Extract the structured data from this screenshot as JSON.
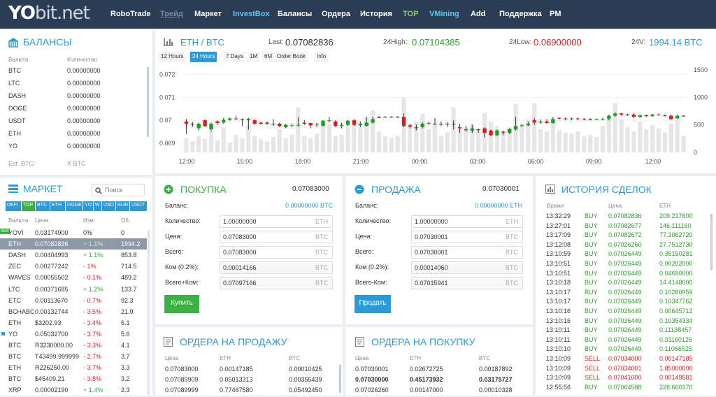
{
  "logo": {
    "yo": "YO",
    "rest": "bit.net"
  },
  "nav": [
    "RoboTrade",
    "Трейд",
    "Маркет",
    "InvestBox",
    "Балансы",
    "Ордера",
    "История",
    "TOP",
    "VMining",
    "Add",
    "Поддержка",
    "PM"
  ],
  "balances": {
    "title": "БАЛАНСЫ",
    "col_currency": "Валюта",
    "col_amount": "Количество",
    "rows": [
      {
        "c": "BTC",
        "v": "0.00000000"
      },
      {
        "c": "LTC",
        "v": "0.00000000"
      },
      {
        "c": "DASH",
        "v": "0.00000000"
      },
      {
        "c": "DOGE",
        "v": "0.00000000"
      },
      {
        "c": "USDT",
        "v": "0.00000000"
      },
      {
        "c": "ETH",
        "v": "0.00000000"
      },
      {
        "c": "YO",
        "v": "0.00000000"
      }
    ],
    "est_label": "Est. BTC:",
    "est_value": "X BTC"
  },
  "market": {
    "title": "МАРКЕТ",
    "search_placeholder": "Поиск",
    "tabs": [
      "DEFI",
      "TOP",
      "BTC",
      "ETH",
      "DOGE",
      "YO",
      "W",
      "USD",
      "RUR",
      "USDT"
    ],
    "col_currency": "Валюта",
    "col_price": "Цена",
    "col_change": "Изм.",
    "col_volume": "Об.",
    "rows": [
      {
        "c": "YOVI",
        "p": "0.03174900",
        "ch": "0%",
        "v": "0",
        "badge": "NEW",
        "tone": "neutral"
      },
      {
        "c": "ETH",
        "p": "0.07082836",
        "ch": "+ 1.1%",
        "v": "1994.2",
        "tone": "up",
        "selected": true
      },
      {
        "c": "DASH",
        "p": "0.00404993",
        "ch": "+ 1.1%",
        "v": "853.8",
        "tone": "up"
      },
      {
        "c": "ZEC",
        "p": "0.00277242",
        "ch": "- 1%",
        "v": "714.5",
        "tone": "down"
      },
      {
        "c": "WAVES",
        "p": "0.00055502",
        "ch": "- 0.1%",
        "v": "489.2",
        "tone": "down"
      },
      {
        "c": "LTC",
        "p": "0.00371685",
        "ch": "+ 1.2%",
        "v": "133.7",
        "tone": "up"
      },
      {
        "c": "ETC",
        "p": "0.00113670",
        "ch": "- 0.7%",
        "v": "92.3",
        "tone": "down"
      },
      {
        "c": "BCHABC",
        "p": "0.00132744",
        "ch": "- 3.5%",
        "v": "21.9",
        "tone": "down"
      },
      {
        "c": "ETH",
        "p": "$3202.93",
        "ch": "- 3.4%",
        "v": "6.1",
        "tone": "down"
      },
      {
        "c": "YO",
        "p": "0.05032700",
        "ch": "- 3.7%",
        "v": "5.6",
        "tone": "down",
        "dot": true
      },
      {
        "c": "BTC",
        "p": "R3230000.00",
        "ch": "- 3.3%",
        "v": "4.1",
        "tone": "down"
      },
      {
        "c": "BTC",
        "p": "T43499.999999",
        "ch": "- 2.7%",
        "v": "3.7",
        "tone": "down"
      },
      {
        "c": "ETH",
        "p": "R226250.00",
        "ch": "- 3.7%",
        "v": "3.3",
        "tone": "down"
      },
      {
        "c": "BTC",
        "p": "$45409.21",
        "ch": "- 3.8%",
        "v": "3.2",
        "tone": "down"
      },
      {
        "c": "XRP",
        "p": "0.00002190",
        "ch": "+ 1.4%",
        "v": "2.3",
        "tone": "up"
      }
    ]
  },
  "ticker": {
    "pair": "ETH / BTC",
    "last_label": "Last:",
    "last_value": "0.07082836",
    "high_label": "24High:",
    "high_value": "0.07104385",
    "low_label": "24Low:",
    "low_value": "0.06900000",
    "vol_label": "24V:",
    "vol_value": "1994.14 BTC"
  },
  "chart_tabs": [
    "12 Hours",
    "24 Hours",
    "7 Days",
    "1M",
    "6M",
    "Order Book",
    "Info"
  ],
  "chart_data": {
    "type": "candlestick",
    "y_left_ticks": [
      "0.072",
      "0.071",
      "0.07",
      "0.069"
    ],
    "y_right_ticks": [
      "1500",
      "1000",
      "500",
      "0"
    ],
    "x_ticks": [
      "12:00",
      "15:00",
      "18:00",
      "21:00",
      "00:00",
      "03:00",
      "06:00",
      "09:00",
      "12:00"
    ],
    "ylim": [
      0.0686,
      0.0722
    ],
    "vol_max": 1500,
    "candles": [
      {
        "o": 0.06995,
        "c": 0.06985,
        "h": 0.07005,
        "l": 0.0694,
        "v": 260
      },
      {
        "o": 0.06985,
        "c": 0.06985,
        "h": 0.06992,
        "l": 0.0697,
        "v": 200
      },
      {
        "o": 0.06965,
        "c": 0.06985,
        "h": 0.0699,
        "l": 0.06955,
        "v": 300
      },
      {
        "o": 0.07,
        "c": 0.06975,
        "h": 0.07005,
        "l": 0.0697,
        "v": 240
      },
      {
        "o": 0.0696,
        "c": 0.06985,
        "h": 0.0699,
        "l": 0.0695,
        "v": 380
      },
      {
        "o": 0.06995,
        "c": 0.06988,
        "h": 0.07,
        "l": 0.0698,
        "v": 220
      },
      {
        "o": 0.0699,
        "c": 0.07002,
        "h": 0.0701,
        "l": 0.06985,
        "v": 460
      },
      {
        "o": 0.07002,
        "c": 0.07008,
        "h": 0.07012,
        "l": 0.06998,
        "v": 180
      },
      {
        "o": 0.07008,
        "c": 0.07005,
        "h": 0.0702,
        "l": 0.07,
        "v": 320
      },
      {
        "o": 0.07005,
        "c": 0.07005,
        "h": 0.07008,
        "l": 0.06975,
        "v": 260
      },
      {
        "o": 0.07005,
        "c": 0.07,
        "h": 0.0701,
        "l": 0.0696,
        "v": 500
      },
      {
        "o": 0.07,
        "c": 0.06985,
        "h": 0.07005,
        "l": 0.0698,
        "v": 300
      },
      {
        "o": 0.0699,
        "c": 0.06985,
        "h": 0.06995,
        "l": 0.0698,
        "v": 250
      },
      {
        "o": 0.0699,
        "c": 0.06985,
        "h": 0.06995,
        "l": 0.0698,
        "v": 200
      },
      {
        "o": 0.06985,
        "c": 0.06985,
        "h": 0.07005,
        "l": 0.06975,
        "v": 280
      },
      {
        "o": 0.06985,
        "c": 0.06975,
        "h": 0.0699,
        "l": 0.0697,
        "v": 420
      },
      {
        "o": 0.0697,
        "c": 0.0698,
        "h": 0.06985,
        "l": 0.06965,
        "v": 260
      },
      {
        "o": 0.06975,
        "c": 0.06978,
        "h": 0.06985,
        "l": 0.0697,
        "v": 320
      },
      {
        "o": 0.06978,
        "c": 0.0698,
        "h": 0.07012,
        "l": 0.06972,
        "v": 820
      },
      {
        "o": 0.0699,
        "c": 0.06985,
        "h": 0.07,
        "l": 0.0698,
        "v": 300
      },
      {
        "o": 0.06988,
        "c": 0.06978,
        "h": 0.0699,
        "l": 0.06965,
        "v": 260
      },
      {
        "o": 0.0698,
        "c": 0.06983,
        "h": 0.0699,
        "l": 0.0697,
        "v": 340
      },
      {
        "o": 0.06975,
        "c": 0.06998,
        "h": 0.07,
        "l": 0.06975,
        "v": 480
      },
      {
        "o": 0.06998,
        "c": 0.07,
        "h": 0.07015,
        "l": 0.0699,
        "v": 520
      },
      {
        "o": 0.06995,
        "c": 0.06975,
        "h": 0.07,
        "l": 0.0697,
        "v": 300
      },
      {
        "o": 0.06975,
        "c": 0.0698,
        "h": 0.0699,
        "l": 0.06965,
        "v": 320
      },
      {
        "o": 0.0698,
        "c": 0.06998,
        "h": 0.07002,
        "l": 0.06975,
        "v": 500
      },
      {
        "o": 0.07,
        "c": 0.0698,
        "h": 0.07005,
        "l": 0.06975,
        "v": 600
      },
      {
        "o": 0.06978,
        "c": 0.06985,
        "h": 0.06995,
        "l": 0.0697,
        "v": 460
      },
      {
        "o": 0.06975,
        "c": 0.0699,
        "h": 0.07015,
        "l": 0.06972,
        "v": 640
      },
      {
        "o": 0.0699,
        "c": 0.07005,
        "h": 0.07015,
        "l": 0.06985,
        "v": 760
      },
      {
        "o": 0.07013,
        "c": 0.07013,
        "h": 0.0702,
        "l": 0.0701,
        "v": 380
      },
      {
        "o": 0.07015,
        "c": 0.07015,
        "h": 0.07018,
        "l": 0.07012,
        "v": 300
      },
      {
        "o": 0.07015,
        "c": 0.07015,
        "h": 0.07018,
        "l": 0.07012,
        "v": 260
      },
      {
        "o": 0.07015,
        "c": 0.07015,
        "h": 0.07018,
        "l": 0.07012,
        "v": 300
      },
      {
        "o": 0.07015,
        "c": 0.06975,
        "h": 0.0703,
        "l": 0.0697,
        "v": 1000
      },
      {
        "o": 0.06978,
        "c": 0.06972,
        "h": 0.06985,
        "l": 0.06965,
        "v": 520
      },
      {
        "o": 0.06965,
        "c": 0.0697,
        "h": 0.06982,
        "l": 0.06955,
        "v": 560
      },
      {
        "o": 0.0697,
        "c": 0.06985,
        "h": 0.06992,
        "l": 0.06965,
        "v": 700
      },
      {
        "o": 0.06985,
        "c": 0.06988,
        "h": 0.06995,
        "l": 0.0698,
        "v": 420
      },
      {
        "o": 0.06985,
        "c": 0.06985,
        "h": 0.0701,
        "l": 0.0698,
        "v": 520
      },
      {
        "o": 0.06985,
        "c": 0.06985,
        "h": 0.06995,
        "l": 0.06975,
        "v": 300
      },
      {
        "o": 0.06985,
        "c": 0.06985,
        "h": 0.06992,
        "l": 0.0697,
        "v": 360
      },
      {
        "o": 0.06985,
        "c": 0.06985,
        "h": 0.07,
        "l": 0.0696,
        "v": 820
      },
      {
        "o": 0.0697,
        "c": 0.06965,
        "h": 0.06985,
        "l": 0.06945,
        "v": 440
      },
      {
        "o": 0.0696,
        "c": 0.0696,
        "h": 0.06975,
        "l": 0.0695,
        "v": 460
      },
      {
        "o": 0.06955,
        "c": 0.06965,
        "h": 0.0698,
        "l": 0.06945,
        "v": 520
      },
      {
        "o": 0.0696,
        "c": 0.0696,
        "h": 0.06965,
        "l": 0.06945,
        "v": 400
      },
      {
        "o": 0.06965,
        "c": 0.06945,
        "h": 0.0697,
        "l": 0.06925,
        "v": 720
      },
      {
        "o": 0.06955,
        "c": 0.06935,
        "h": 0.0696,
        "l": 0.0693,
        "v": 560
      },
      {
        "o": 0.06935,
        "c": 0.06955,
        "h": 0.0696,
        "l": 0.0693,
        "v": 480
      },
      {
        "o": 0.0695,
        "c": 0.06945,
        "h": 0.06955,
        "l": 0.06935,
        "v": 360
      },
      {
        "o": 0.06945,
        "c": 0.06962,
        "h": 0.06965,
        "l": 0.0694,
        "v": 460
      },
      {
        "o": 0.0696,
        "c": 0.06975,
        "h": 0.07015,
        "l": 0.06955,
        "v": 880
      },
      {
        "o": 0.06975,
        "c": 0.06978,
        "h": 0.06985,
        "l": 0.0697,
        "v": 520
      },
      {
        "o": 0.06978,
        "c": 0.06985,
        "h": 0.06995,
        "l": 0.06975,
        "v": 600
      },
      {
        "o": 0.07,
        "c": 0.0699,
        "h": 0.0701,
        "l": 0.0698,
        "v": 900
      },
      {
        "o": 0.0699,
        "c": 0.06995,
        "h": 0.07005,
        "l": 0.06985,
        "v": 420
      },
      {
        "o": 0.06995,
        "c": 0.06988,
        "h": 0.07005,
        "l": 0.06985,
        "v": 380
      },
      {
        "o": 0.06988,
        "c": 0.07005,
        "h": 0.07015,
        "l": 0.06985,
        "v": 620
      },
      {
        "o": 0.0701,
        "c": 0.07008,
        "h": 0.07015,
        "l": 0.07003,
        "v": 400
      },
      {
        "o": 0.07008,
        "c": 0.07006,
        "h": 0.07012,
        "l": 0.07,
        "v": 360
      },
      {
        "o": 0.07006,
        "c": 0.07008,
        "h": 0.07012,
        "l": 0.07,
        "v": 340
      },
      {
        "o": 0.07008,
        "c": 0.07006,
        "h": 0.07012,
        "l": 0.07,
        "v": 380
      },
      {
        "o": 0.07006,
        "c": 0.07004,
        "h": 0.0701,
        "l": 0.07,
        "v": 300
      },
      {
        "o": 0.07004,
        "c": 0.07004,
        "h": 0.07008,
        "l": 0.07,
        "v": 320
      },
      {
        "o": 0.07004,
        "c": 0.07005,
        "h": 0.07008,
        "l": 0.07,
        "v": 280
      },
      {
        "o": 0.07005,
        "c": 0.07006,
        "h": 0.07012,
        "l": 0.07,
        "v": 480
      },
      {
        "o": 0.07006,
        "c": 0.0702,
        "h": 0.07025,
        "l": 0.07,
        "v": 620
      },
      {
        "o": 0.0702,
        "c": 0.0703,
        "h": 0.07035,
        "l": 0.07015,
        "v": 900
      },
      {
        "o": 0.0703,
        "c": 0.07025,
        "h": 0.07033,
        "l": 0.0702,
        "v": 600
      },
      {
        "o": 0.07025,
        "c": 0.07025,
        "h": 0.07028,
        "l": 0.0702,
        "v": 460
      },
      {
        "o": 0.07025,
        "c": 0.07015,
        "h": 0.0703,
        "l": 0.0701,
        "v": 380
      },
      {
        "o": 0.07015,
        "c": 0.07022,
        "h": 0.07025,
        "l": 0.0701,
        "v": 560
      },
      {
        "o": 0.07022,
        "c": 0.07018,
        "h": 0.07025,
        "l": 0.07015,
        "v": 420
      },
      {
        "o": 0.07018,
        "c": 0.07025,
        "h": 0.07028,
        "l": 0.07015,
        "v": 500
      },
      {
        "o": 0.07025,
        "c": 0.07022,
        "h": 0.0703,
        "l": 0.0702,
        "v": 440
      },
      {
        "o": 0.07022,
        "c": 0.0702,
        "h": 0.07025,
        "l": 0.07015,
        "v": 360
      },
      {
        "o": 0.0702,
        "c": 0.07005,
        "h": 0.07025,
        "l": 0.07,
        "v": 520
      },
      {
        "o": 0.07008,
        "c": 0.0702,
        "h": 0.07025,
        "l": 0.07005,
        "v": 600
      },
      {
        "o": 0.0702,
        "c": 0.0702,
        "h": 0.07022,
        "l": 0.07018,
        "v": 300
      }
    ]
  },
  "buy": {
    "title": "ПОКУПКА",
    "price": "0.07083000",
    "balance_label": "Баланс:",
    "balance_value": "0.00000000 BTC",
    "qty_label": "Количество:",
    "qty_value": "1.00000000",
    "qty_unit": "ETH",
    "price_label": "Цена:",
    "price_value": "0.07083000",
    "price_unit": "BTC",
    "total_label": "Всего:",
    "total_value": "0.07083000",
    "total_unit": "BTC",
    "fee_label": "Ком (0.2%):",
    "fee_value": "0.00014166",
    "fee_unit": "BTC",
    "grand_label": "Всего+Ком:",
    "grand_value": "0.07097166",
    "grand_unit": "BTC",
    "button": "Купить"
  },
  "sell": {
    "title": "ПРОДАЖА",
    "price": "0.07030001",
    "balance_label": "Баланс:",
    "balance_value": "0.00000000 ETH",
    "qty_label": "Количество:",
    "qty_value": "1.00000000",
    "qty_unit": "ETH",
    "price_label": "Цена:",
    "price_value": "0.07030001",
    "price_unit": "BTC",
    "total_label": "Всего:",
    "total_value": "0.07030001",
    "total_unit": "BTC",
    "fee_label": "Ком (0.2%):",
    "fee_value": "0.00014060",
    "fee_unit": "BTC",
    "grand_label": "Всего-Ком:",
    "grand_value": "0.07015941",
    "grand_unit": "BTC",
    "button": "Продать"
  },
  "sell_orders": {
    "title": "ОРДЕРА НА ПРОДАЖУ",
    "cols": [
      "Цена",
      "ETH",
      "BTC"
    ],
    "rows": [
      [
        "0.07083000",
        "0.00147185",
        "0.00010425"
      ],
      [
        "0.07089909",
        "0.05013313",
        "0.00355439"
      ],
      [
        "0.07089999",
        "0.77467580",
        "0.05492450"
      ]
    ]
  },
  "buy_orders": {
    "title": "ОРДЕРА НА ПОКУПКУ",
    "cols": [
      "Цена",
      "ETH",
      "BTC"
    ],
    "rows": [
      [
        "0.07030001",
        "0.02672725",
        "0.00187892"
      ],
      [
        "0.07030000",
        "0.45173932",
        "0.03175727"
      ],
      [
        "0.07026260",
        "0.00147000",
        "0.00010328"
      ]
    ]
  },
  "history": {
    "title": "ИСТОРИЯ СДЕЛОК",
    "cols": [
      "Время",
      "Цена",
      "ETH"
    ],
    "rows": [
      [
        "13:32:29",
        "BUY",
        "0.07082836",
        "209.217600"
      ],
      [
        "13:27:01",
        "BUY",
        "0.07082677",
        "146.111160"
      ],
      [
        "13:17:09",
        "BUY",
        "0.07082672",
        "77.3062720"
      ],
      [
        "13:12:08",
        "BUY",
        "0.07026260",
        "27.7512730"
      ],
      [
        "13:10:59",
        "BUY",
        "0.07026449",
        "0.35150281"
      ],
      [
        "13:10:51",
        "BUY",
        "0.07026449",
        "0.00202000"
      ],
      [
        "13:10:51",
        "BUY",
        "0.07026449",
        "0.04690000"
      ],
      [
        "13:10:18",
        "BUY",
        "0.07026449",
        "14.4148000"
      ],
      [
        "13:10:17",
        "BUY",
        "0.07026449",
        "0.10280959"
      ],
      [
        "13:10:17",
        "BUY",
        "0.07026449",
        "0.10347762"
      ],
      [
        "13:10:16",
        "BUY",
        "0.07026449",
        "0.00645712"
      ],
      [
        "13:10:16",
        "BUY",
        "0.07026449",
        "0.10354334"
      ],
      [
        "13:10:11",
        "BUY",
        "0.07026449",
        "0.11138457"
      ],
      [
        "13:10:11",
        "BUY",
        "0.07026449",
        "0.31160126"
      ],
      [
        "13:10:10",
        "BUY",
        "0.07026449",
        "0.11066525"
      ],
      [
        "13:10:09",
        "SELL",
        "0.07034000",
        "0.00147185"
      ],
      [
        "13:10:09",
        "SELL",
        "0.07034001",
        "1.85000000"
      ],
      [
        "13:10:09",
        "SELL",
        "0.07041000",
        "0.00149581"
      ],
      [
        "12:55:56",
        "BUY",
        "0.07064588",
        "228.600170"
      ]
    ]
  }
}
